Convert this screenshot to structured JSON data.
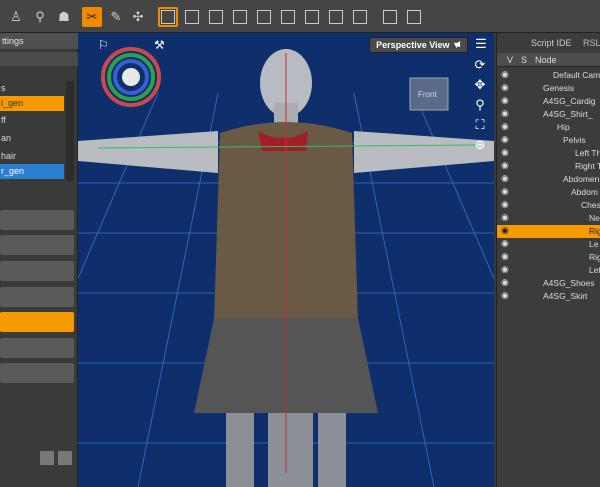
{
  "left_panel": {
    "header": "ttings",
    "list": [
      "s",
      "l_gen",
      "ff",
      "an",
      "hair",
      "r_gen"
    ]
  },
  "viewport": {
    "view_label": "Perspective View",
    "dropdown": "▼",
    "cube_label": "Front",
    "bg": "#0e2f6c"
  },
  "right_panel": {
    "tabs": [
      "Script IDE",
      "RSL"
    ],
    "columns": [
      "V",
      "S",
      "Node"
    ],
    "nodes": [
      "Default Came",
      "Genesis",
      "A4SG_Cardig",
      "A4SG_Shirt_",
      "Hip",
      "Pelvis",
      "Left Th",
      "Right T",
      "Abdomen",
      "Abdom",
      "Ches",
      "Ne",
      "Rig",
      "Le",
      "Rig",
      "Lef",
      "A4SG_Shoes",
      "A4SG_Skirt"
    ],
    "highlight_index": 12
  },
  "colors": {
    "accent": "#f59a00",
    "selection_blue": "#2a7fd0",
    "viewport_bg": "#0e2f6c"
  }
}
